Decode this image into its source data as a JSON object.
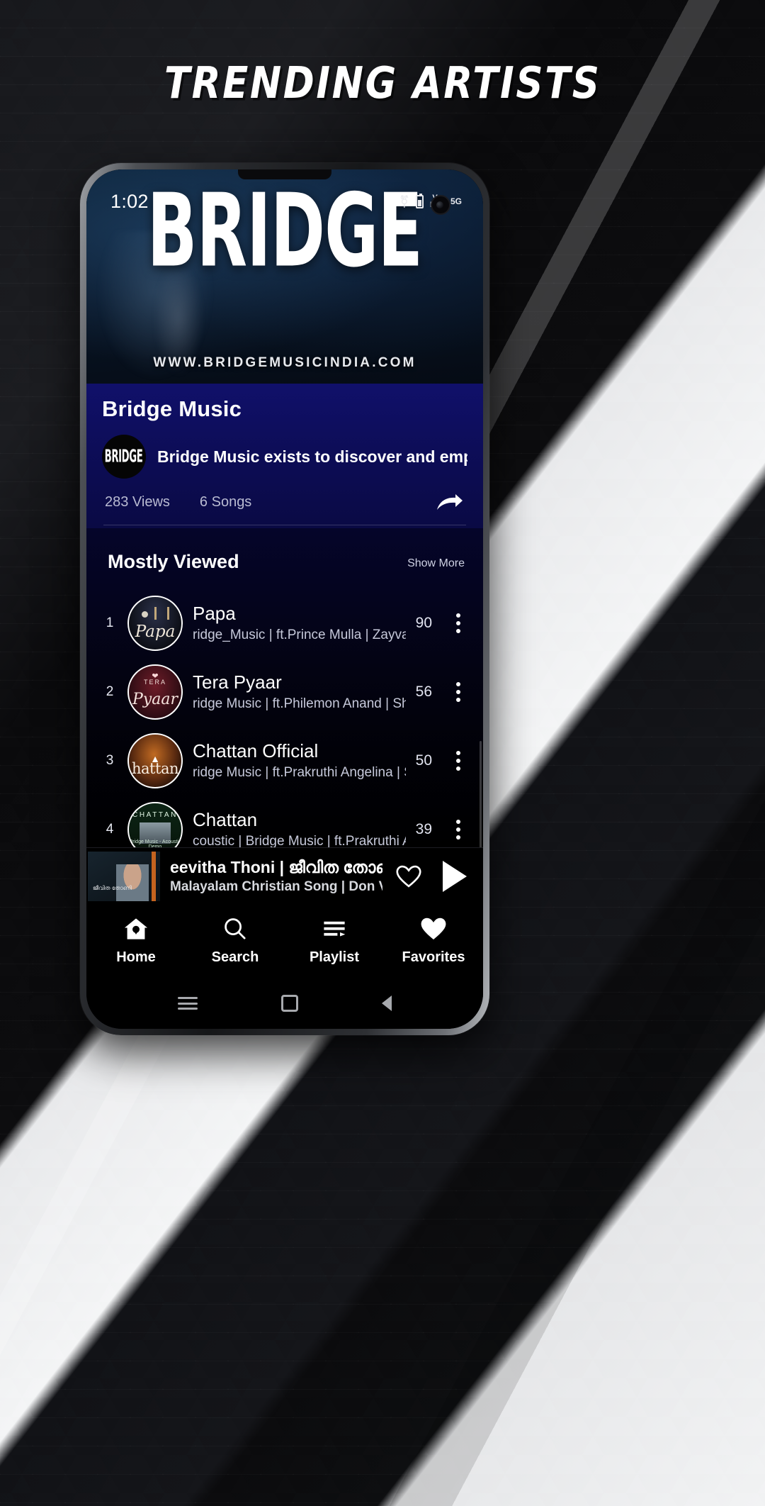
{
  "poster": {
    "headline": "TRENDING ARTISTS"
  },
  "statusbar": {
    "time": "1:02",
    "bluetooth_icon": "bluetooth-icon",
    "volte_label_top": "Vo",
    "volte_label_bottom": "LTE",
    "network": "5G"
  },
  "hero": {
    "logo_text": "BRIDGE",
    "url": "WWW.BRIDGEMUSICINDIA.COM"
  },
  "artist": {
    "name": "Bridge Music",
    "avatar_text": "BRIDGE",
    "description": "Bridge Music exists to discover and empower ra",
    "views": "283 Views",
    "songs": "6 Songs",
    "share_icon": "share-icon"
  },
  "section": {
    "title": "Mostly Viewed",
    "show_more": "Show More"
  },
  "songs": [
    {
      "rank": "1",
      "title": "Papa",
      "subtitle": "ridge_Music | ft.Prince Mulla | Zayvan",
      "count": "90",
      "art_label": "Papa",
      "art_style": "art-papa"
    },
    {
      "rank": "2",
      "title": "Tera Pyaar",
      "subtitle": "ridge Music | ft.Philemon Anand | She",
      "count": "56",
      "art_label": "Pyaar",
      "art_tag": "TERA",
      "art_style": "art-tera"
    },
    {
      "rank": "3",
      "title": "Chattan Official",
      "subtitle": "ridge Music | ft.Prakruthi Angelina | So",
      "count": "50",
      "art_label": "hattan",
      "art_style": "art-chof"
    },
    {
      "rank": "4",
      "title": "Chattan",
      "subtitle": "coustic | Bridge Music | ft.Prakruthi An",
      "count": "39",
      "art_label": "CHATTAN",
      "art_caption": "Bridge Music - Acoustic Demo",
      "art_style": "art-cha"
    }
  ],
  "nowplaying": {
    "title": "eevitha Thoni | ജീവിത തോണി",
    "subtitle": "Malayalam Christian Song | Don Vali...",
    "like_icon": "heart-outline-icon",
    "play_icon": "play-icon",
    "art_caption": "ജീവിത തോണി"
  },
  "tabs": [
    {
      "label": "Home",
      "icon": "home-pin-icon"
    },
    {
      "label": "Search",
      "icon": "search-icon"
    },
    {
      "label": "Playlist",
      "icon": "playlist-icon"
    },
    {
      "label": "Favorites",
      "icon": "heart-filled-icon"
    }
  ],
  "androidnav": {
    "menu_icon": "menu-icon",
    "home_icon": "square-home-icon",
    "back_icon": "back-triangle-icon"
  },
  "colors": {
    "artist_card_bg": "#0d0d58",
    "list_bg": "#04041e",
    "accent_white": "#ffffff"
  }
}
